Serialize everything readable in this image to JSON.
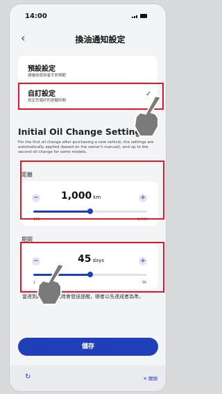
{
  "status": {
    "time": "14:00"
  },
  "nav": {
    "title": "換油通知設定"
  },
  "options": [
    {
      "title": "預設設定",
      "subtitle": "建議依使用者手冊規範"
    },
    {
      "title": "自訂設定",
      "subtitle": "設定您偏好的提醒時間"
    }
  ],
  "section": {
    "title": "Initial Oil Change Settings",
    "description": "For the first oil change after purchasing a new vehicle, the settings are automatically applied (based on the owner's manual), and up to the second oil change for some models."
  },
  "distance": {
    "label": "距離",
    "value": "1,000",
    "unit": "km",
    "min_label": "120",
    "max_label": "2,000",
    "fraction": 0.5
  },
  "period": {
    "label": "期間",
    "value": "45",
    "unit": "days",
    "min_label": "1",
    "max_label": "90",
    "fraction": 0.5
  },
  "footnote": "當達到距離或期間時會發送提醒，哪者以先達成者為準。",
  "buttons": {
    "save": "儲存",
    "close": "關閉"
  },
  "colors": {
    "accent": "#1f3fb8",
    "highlight": "#e2172a"
  }
}
